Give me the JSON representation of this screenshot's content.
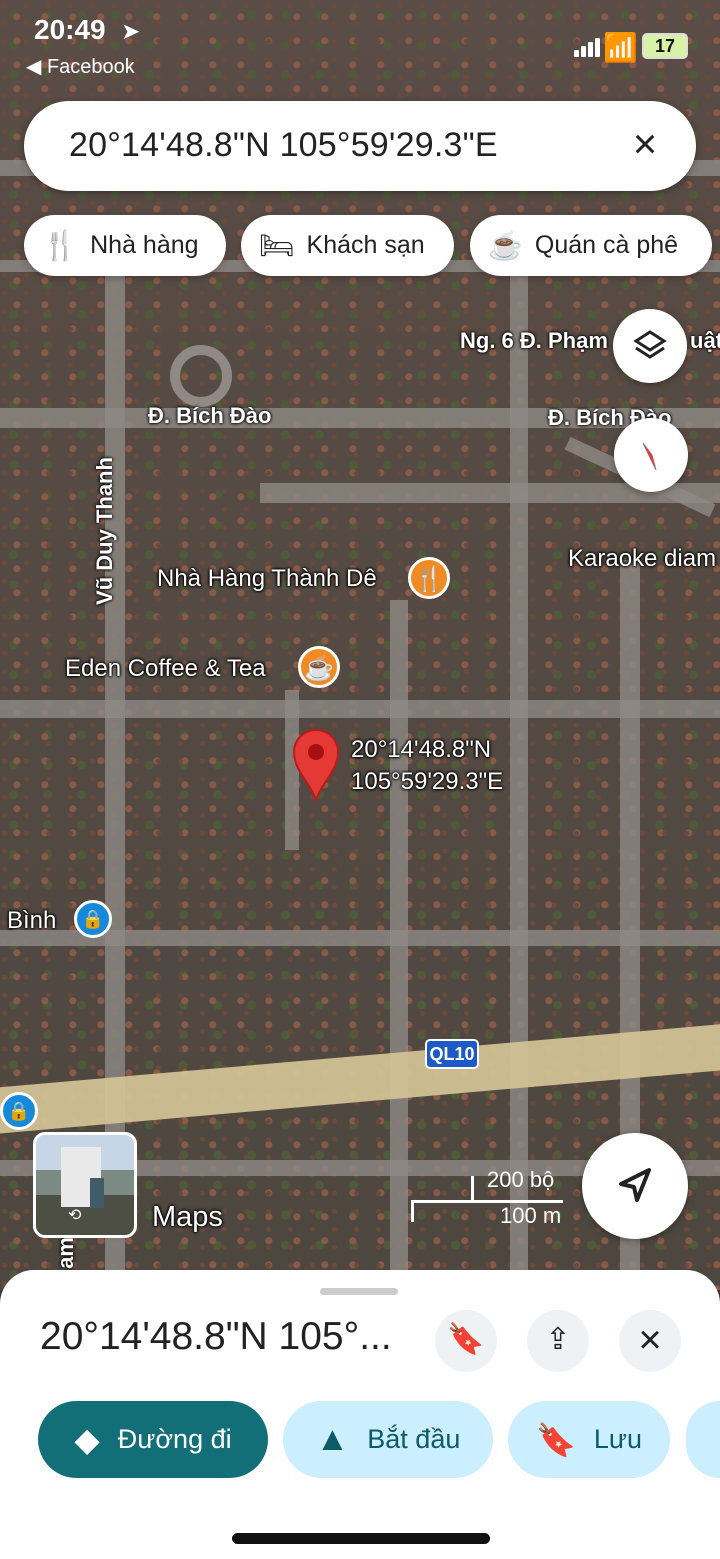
{
  "status": {
    "time": "20:49",
    "back_app": "Facebook",
    "battery": "17"
  },
  "search": {
    "text": "20°14'48.8\"N 105°59'29.3\"E",
    "clear_icon": "close-icon"
  },
  "chips": [
    {
      "label": "Nhà hàng",
      "icon": "fork-knife-icon"
    },
    {
      "label": "Khách sạn",
      "icon": "bed-icon"
    },
    {
      "label": "Quán cà phê",
      "icon": "coffee-icon"
    }
  ],
  "map": {
    "street_ng6": "Ng. 6 Đ. Phạm",
    "street_ng6_fragment": "uật",
    "street_bich_dao_left": "Đ. Bích Đào",
    "street_bich_dao_right": "Đ. Bích Đào",
    "street_vu_duy_thanh": "Vũ Duy Thanh",
    "karaoke": "Karaoke diam",
    "restaurant": "Nhà Hàng Thành Dê",
    "coffee": "Eden Coffee & Tea",
    "pin_line1": "20°14'48.8\"N",
    "pin_line2": "105°59'29.3\"E",
    "place_binh": "Bình",
    "road_ql10": "QL10",
    "scale_top": "200 bộ",
    "scale_bottom": "100 m",
    "maps_label": "Maps",
    "bottom_left_fragment": "am"
  },
  "sheet": {
    "title": "20°14'48.8\"N 105°...",
    "actions": [
      {
        "label": "Đường đi",
        "icon": "directions-icon"
      },
      {
        "label": "Bắt đầu",
        "icon": "navigation-arrow-icon"
      },
      {
        "label": "Lưu",
        "icon": "bookmark-icon"
      }
    ]
  }
}
